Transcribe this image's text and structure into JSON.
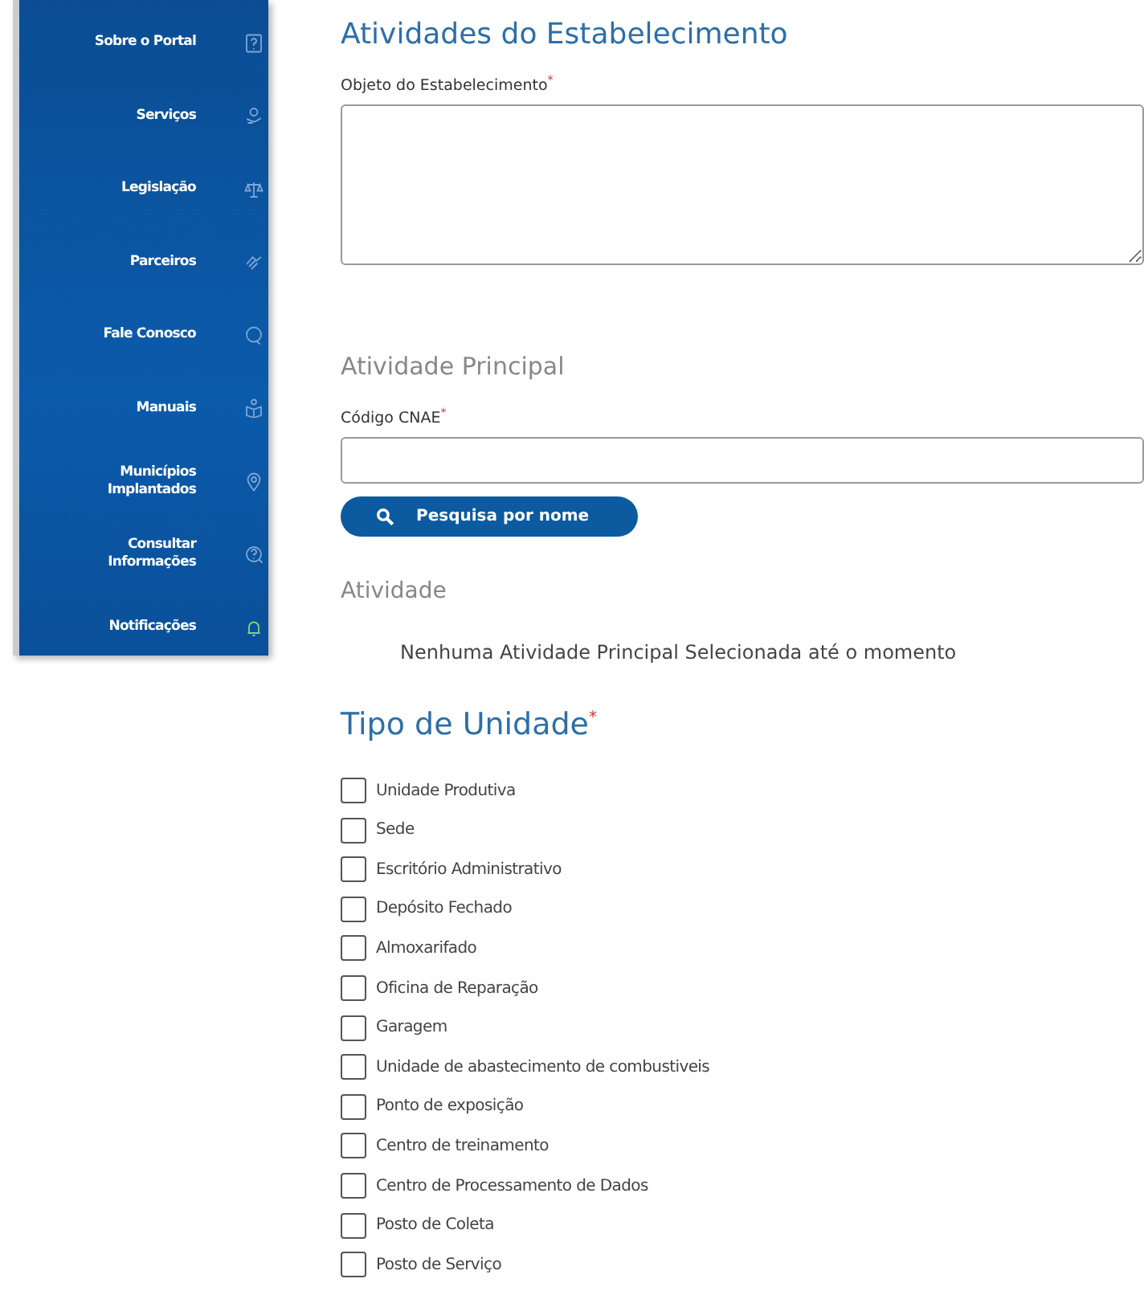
{
  "sidebar": {
    "items": [
      {
        "label": "Sobre o Portal",
        "highlight": false
      },
      {
        "label": "Serviços",
        "highlight": false
      },
      {
        "label": "Legislação",
        "highlight": false
      },
      {
        "label": "Parceiros",
        "highlight": false
      },
      {
        "label": "Fale Conosco",
        "highlight": false
      },
      {
        "label": "Manuais",
        "highlight": false
      },
      {
        "label": "Municípios Implantados",
        "highlight": false
      },
      {
        "label": "Consultar Informações",
        "highlight": false
      },
      {
        "label": "Notificações",
        "highlight": true
      }
    ]
  },
  "form": {
    "title": "Atividades do Estabelecimento",
    "objeto_label": "Objeto do Estabelecimento",
    "objeto_required": "*",
    "principal_title": "Atividade Principal",
    "cnae_label": "Código CNAE",
    "cnae_required": "*",
    "search_button": "Pesquisa por nome",
    "atividade_title": "Atividade",
    "atividade_message": "Nenhuma Atividade Principal Selecionada até o momento",
    "tipo_title": "Tipo de Unidade",
    "tipo_required": "*",
    "tipos": [
      {
        "label": "Unidade Produtiva",
        "checked": false
      },
      {
        "label": "Sede",
        "checked": false
      },
      {
        "label": "Escritório Administrativo",
        "checked": false
      },
      {
        "label": "Depósito Fechado",
        "checked": false
      },
      {
        "label": "Almoxarifado",
        "checked": false
      },
      {
        "label": "Oficina de Reparação",
        "checked": false
      },
      {
        "label": "Garagem",
        "checked": false
      },
      {
        "label": "Unidade de abastecimento de combustiveis",
        "checked": false
      },
      {
        "label": "Ponto de exposição",
        "checked": false
      },
      {
        "label": "Centro de treinamento",
        "checked": false
      },
      {
        "label": "Centro de Processamento de Dados",
        "checked": false
      },
      {
        "label": "Posto de Coleta",
        "checked": false
      },
      {
        "label": "Posto de Serviço",
        "checked": false
      }
    ]
  }
}
